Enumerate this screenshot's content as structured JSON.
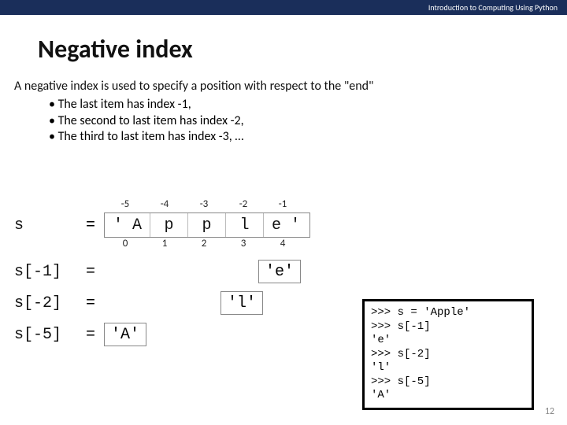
{
  "header": {
    "course": "Introduction to Computing Using Python"
  },
  "title": "Negative index",
  "intro": "A negative index is used to specify a position with respect to the \"end\"",
  "bullets": [
    "The last item has index -1,",
    "The second to last item has index -2,",
    "The third to last item has index -3, …"
  ],
  "chart_data": {
    "type": "table",
    "title": "String s = 'Apple' with negative and positive indices",
    "variable": "s",
    "negative_indices": [
      "-5",
      "-4",
      "-3",
      "-2",
      "-1"
    ],
    "cells": [
      "' A",
      "p",
      "p",
      "l",
      "e '"
    ],
    "positive_indices": [
      "0",
      "1",
      "2",
      "3",
      "4"
    ]
  },
  "results": [
    {
      "lhs": "s[-1]",
      "value": "'e'",
      "offset": 318
    },
    {
      "lhs": "s[-2]",
      "value": "'l'",
      "offset": 270
    },
    {
      "lhs": "s[-5]",
      "value": "'A'",
      "offset": 122
    }
  ],
  "console_lines": [
    ">>> s = 'Apple'",
    ">>> s[-1]",
    "'e'",
    ">>> s[-2]",
    "'l'",
    ">>> s[-5]",
    "'A'"
  ],
  "page_number": "12"
}
